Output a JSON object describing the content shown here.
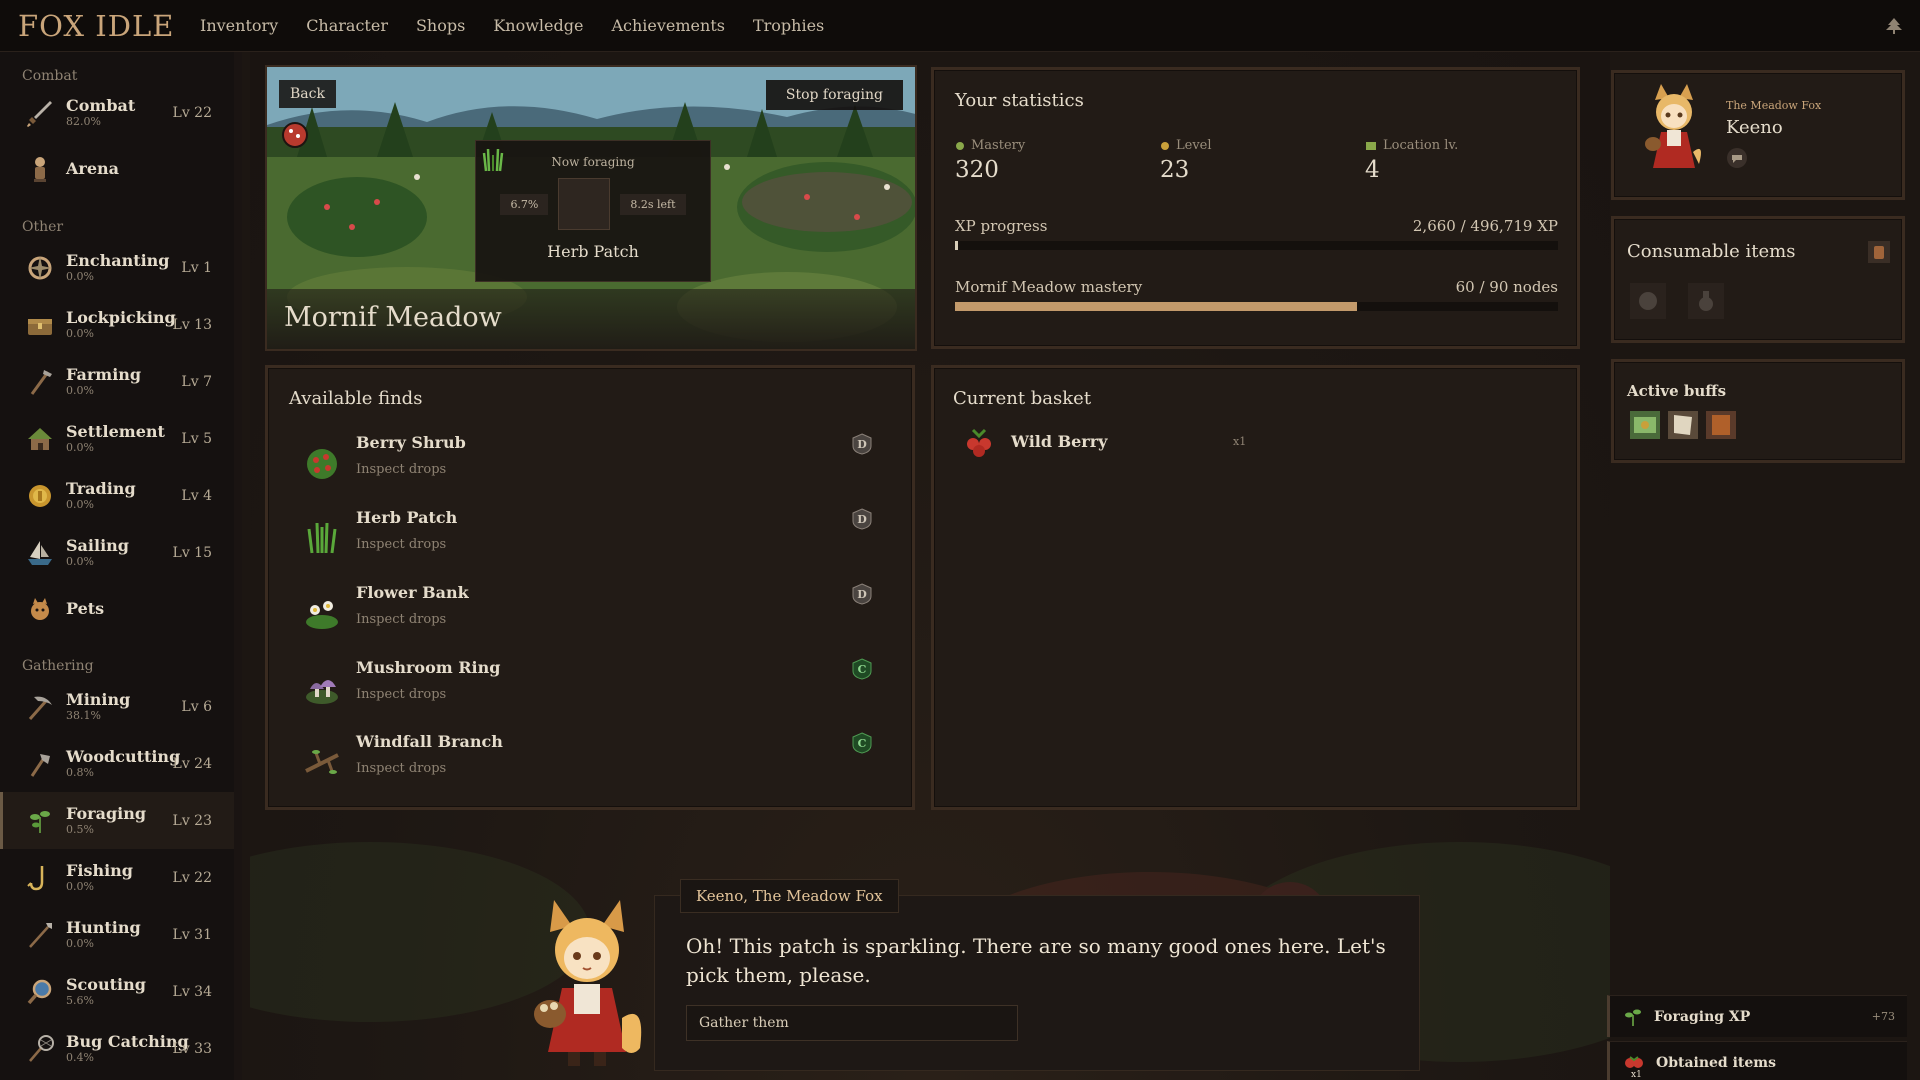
{
  "app": {
    "logo": "FOX IDLE"
  },
  "nav": [
    "Inventory",
    "Character",
    "Shops",
    "Knowledge",
    "Achievements",
    "Trophies"
  ],
  "sidebar": {
    "groups": {
      "combat": "Combat",
      "other": "Other",
      "gathering": "Gathering"
    },
    "combat": [
      {
        "name": "Combat",
        "pct": "82.0%",
        "lv": "Lv 22",
        "icon": "sword-icon"
      },
      {
        "name": "Arena",
        "pct": "",
        "lv": "",
        "icon": "arena-icon"
      }
    ],
    "other": [
      {
        "name": "Enchanting",
        "pct": "0.0%",
        "lv": "Lv 1",
        "icon": "enchant-icon"
      },
      {
        "name": "Lockpicking",
        "pct": "0.0%",
        "lv": "Lv 13",
        "icon": "chest-icon"
      },
      {
        "name": "Farming",
        "pct": "0.0%",
        "lv": "Lv 7",
        "icon": "hoe-icon"
      },
      {
        "name": "Settlement",
        "pct": "0.0%",
        "lv": "Lv 5",
        "icon": "house-icon"
      },
      {
        "name": "Trading",
        "pct": "0.0%",
        "lv": "Lv 4",
        "icon": "coin-icon"
      },
      {
        "name": "Sailing",
        "pct": "0.0%",
        "lv": "Lv 15",
        "icon": "ship-icon"
      },
      {
        "name": "Pets",
        "pct": "",
        "lv": "",
        "icon": "pet-icon"
      }
    ],
    "gathering": [
      {
        "name": "Mining",
        "pct": "38.1%",
        "lv": "Lv 6",
        "icon": "pickaxe-icon"
      },
      {
        "name": "Woodcutting",
        "pct": "0.8%",
        "lv": "Lv 24",
        "icon": "axe-icon"
      },
      {
        "name": "Foraging",
        "pct": "0.5%",
        "lv": "Lv 23",
        "icon": "herb-icon"
      },
      {
        "name": "Fishing",
        "pct": "0.0%",
        "lv": "Lv 22",
        "icon": "hook-icon"
      },
      {
        "name": "Hunting",
        "pct": "0.0%",
        "lv": "Lv 31",
        "icon": "spear-icon"
      },
      {
        "name": "Scouting",
        "pct": "5.6%",
        "lv": "Lv 34",
        "icon": "magnifier-icon"
      },
      {
        "name": "Bug Catching",
        "pct": "0.4%",
        "lv": "Lv 33",
        "icon": "net-icon"
      }
    ]
  },
  "scene": {
    "back": "Back",
    "stop": "Stop foraging",
    "now_label": "Now foraging",
    "progress": "6.7%",
    "time_left": "8.2s left",
    "node_name": "Herb Patch",
    "location": "Mornif Meadow"
  },
  "stats": {
    "title": "Your statistics",
    "mastery_label": "Mastery",
    "mastery_val": "320",
    "level_label": "Level",
    "level_val": "23",
    "loc_label": "Location lv.",
    "loc_val": "4",
    "xp_label": "XP progress",
    "xp_val": "2,660 / 496,719 XP",
    "xp_fraction": 0.005,
    "mastery_bar_label": "Mornif Meadow mastery",
    "mastery_bar_val": "60 / 90 nodes",
    "mastery_fraction": 0.667
  },
  "finds": {
    "title": "Available finds",
    "items": [
      {
        "name": "Berry Shrub",
        "sub": "Inspect drops",
        "badge": "D",
        "icon": "berry-shrub-icon"
      },
      {
        "name": "Herb Patch",
        "sub": "Inspect drops",
        "badge": "D",
        "icon": "herb-patch-icon"
      },
      {
        "name": "Flower Bank",
        "sub": "Inspect drops",
        "badge": "D",
        "icon": "flower-icon"
      },
      {
        "name": "Mushroom Ring",
        "sub": "Inspect drops",
        "badge": "C",
        "icon": "mushroom-icon"
      },
      {
        "name": "Windfall Branch",
        "sub": "Inspect drops",
        "badge": "C",
        "icon": "branch-icon"
      }
    ]
  },
  "basket": {
    "title": "Current basket",
    "items": [
      {
        "name": "Wild Berry",
        "qty": "x1",
        "icon": "berry-icon"
      }
    ]
  },
  "profile": {
    "title": "The Meadow Fox",
    "name": "Keeno"
  },
  "consumables": {
    "title": "Consumable items"
  },
  "buffs": {
    "title": "Active buffs"
  },
  "dialog": {
    "speaker": "Keeno, The Meadow Fox",
    "text": "Oh! This patch is sparkling. There are so many good ones here. Let's pick them, please.",
    "button": "Gather them"
  },
  "toasts": [
    {
      "label": "Foraging XP",
      "value": "+73"
    },
    {
      "label": "Obtained items",
      "value": "",
      "badge": "x1"
    }
  ],
  "colors": {
    "accent": "#c9a57a",
    "mastery_bar": "#c39a6b",
    "badge_d": "#8a8078",
    "badge_c": "#4e9a52"
  }
}
